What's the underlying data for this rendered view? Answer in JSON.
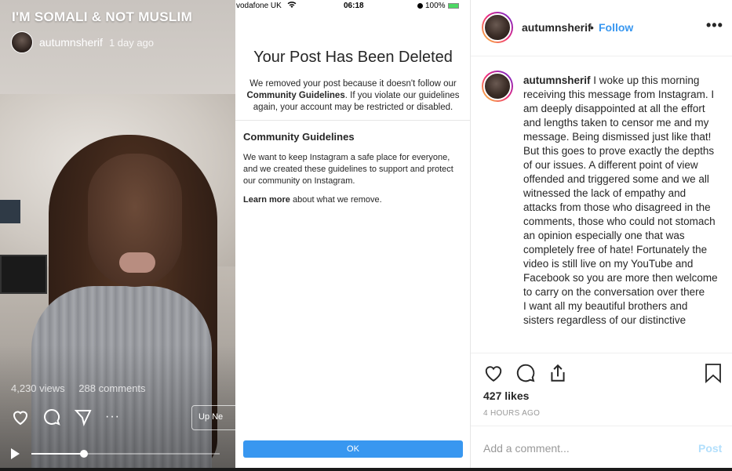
{
  "video": {
    "title": "I'M SOMALI & NOT MUSLIM",
    "username": "autumnsherif",
    "time": "1 day ago",
    "views": "4,230 views",
    "comments": "288 comments",
    "more": "···",
    "up_next": "Up Ne",
    "progress_fraction": 0.28
  },
  "phone": {
    "carrier": "vodafone UK",
    "clock": "06:18",
    "battery": "100%",
    "heading": "Your Post Has Been Deleted",
    "text_1": "We removed your post because it doesn't follow our",
    "text_bold": "Community Guidelines",
    "text_2": ". If you violate our guidelines again, your account may be restricted or disabled.",
    "sub_heading": "Community Guidelines",
    "body": "We want to keep Instagram a safe place for everyone, and we created these guidelines to support and protect our community on Instagram.",
    "learn_bold": "Learn more",
    "learn_rest": " about what we remove.",
    "ok_label": "OK"
  },
  "post": {
    "username": "autumnsherif",
    "dot": "•",
    "follow": "Follow",
    "more": "•••",
    "caption_user": "autumnsherif",
    "caption": " I woke up this morning receiving this message from Instagram. I am deeply disappointed at all the effort and lengths taken to censor me and my message. Being dismissed just like that! But this goes to prove exactly the depths of our issues. A different point of view offended and triggered some and we all witnessed the lack of empathy and attacks from those who disagreed in the comments, those who could not stomach an opinion especially one that was completely free of hate! Fortunately the video is still live on my YouTube and Facebook so you are more then welcome to carry on the conversation over there",
    "caption_2": "I want all my beautiful brothers and sisters regardless of our distinctive",
    "likes": "427 likes",
    "ago": "4 HOURS AGO",
    "comment_placeholder": "Add a comment...",
    "post_label": "Post"
  },
  "colors": {
    "accent": "#3897f0",
    "post_disabled": "#b2dffc",
    "muted": "#999999"
  },
  "icons": [
    "heart-icon",
    "comment-icon",
    "share-icon",
    "bookmark-icon",
    "play-icon",
    "wifi-icon",
    "alarm-icon",
    "battery-icon"
  ]
}
